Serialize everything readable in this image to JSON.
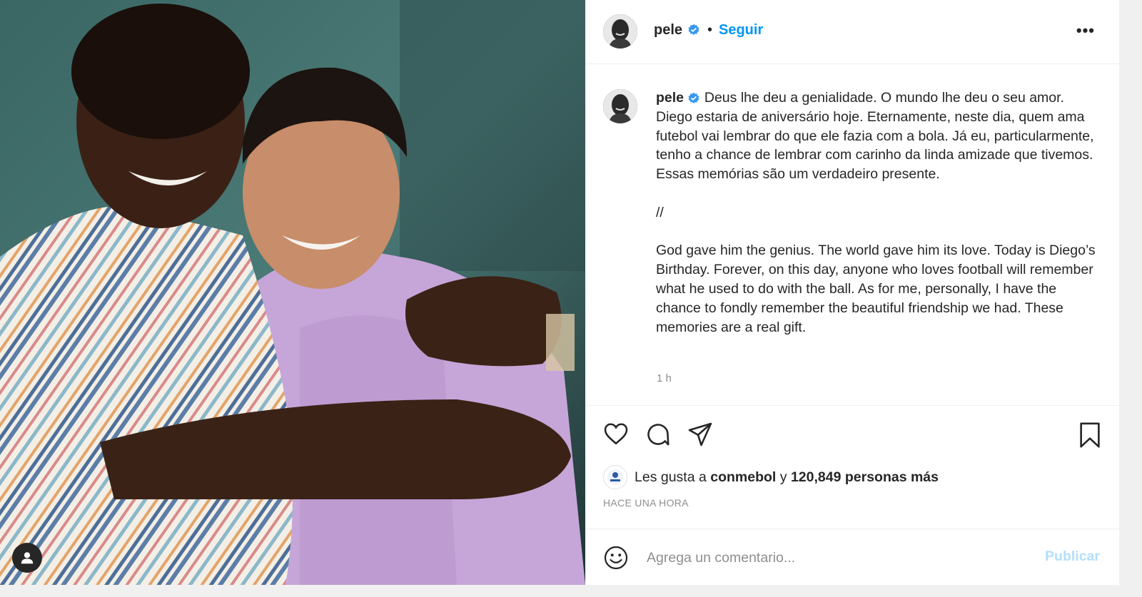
{
  "header": {
    "username": "pele",
    "separator": "•",
    "follow_label": "Seguir",
    "more_label": "•••"
  },
  "caption": {
    "username": "pele",
    "text_pt": "Deus lhe deu a genialidade. O mundo lhe deu o seu amor. Diego estaria de aniversário hoje. Eternamente, neste dia, quem ama futebol vai lembrar do que ele fazia com a bola. Já eu, particularmente, tenho a chance de lembrar com carinho da linda amizade que tivemos. Essas memórias são um verdadeiro presente.",
    "divider": "//",
    "text_en": "God gave him the genius. The world gave him its love. Today is Diego’s Birthday. Forever, on this day, anyone who loves football will remember what he used to do with the ball. As for me, personally, I have the chance to fondly remember the beautiful friendship we had. These memories are a real gift.",
    "time_ago": "1 h"
  },
  "likes": {
    "prefix": "Les gusta a",
    "first_liker": "conmebol",
    "joiner": "y",
    "others": "120,849 personas más"
  },
  "date_label": "HACE UNA HORA",
  "comment": {
    "placeholder": "Agrega un comentario...",
    "publish_label": "Publicar"
  },
  "colors": {
    "accent": "#0095f6",
    "accent_disabled": "#b2dffc",
    "muted": "#8e8e8e",
    "text": "#262626",
    "divider": "#efefef"
  },
  "icons": [
    "heart-icon",
    "comment-icon",
    "share-icon",
    "bookmark-icon",
    "verified-icon",
    "user-tag-icon",
    "emoji-icon"
  ]
}
